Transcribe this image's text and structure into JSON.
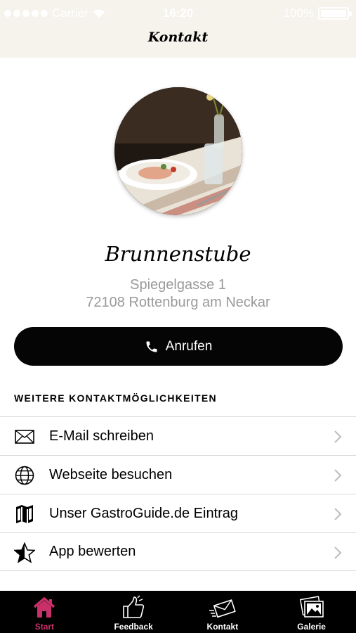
{
  "status_bar": {
    "carrier": "Carrier",
    "time": "16:20",
    "battery": "100%"
  },
  "nav": {
    "title": "Kontakt"
  },
  "restaurant": {
    "name": "Brunnenstube",
    "street": "Spiegelgasse 1",
    "city": "72108 Rottenburg am Neckar"
  },
  "call_button": {
    "label": "Anrufen"
  },
  "section": {
    "title": "WEITERE KONTAKTMÖGLICHKEITEN"
  },
  "contact_options": [
    {
      "label": "E-Mail schreiben",
      "icon": "envelope-icon"
    },
    {
      "label": "Webseite besuchen",
      "icon": "globe-icon"
    },
    {
      "label": "Unser GastroGuide.de Eintrag",
      "icon": "map-icon"
    },
    {
      "label": "App bewerten",
      "icon": "star-icon"
    }
  ],
  "tabs": [
    {
      "label": "Start",
      "icon": "home-icon",
      "active": true
    },
    {
      "label": "Feedback",
      "icon": "thumbs-up-icon",
      "active": false
    },
    {
      "label": "Kontakt",
      "icon": "envelope-icon",
      "active": false
    },
    {
      "label": "Galerie",
      "icon": "photos-icon",
      "active": false
    }
  ],
  "colors": {
    "accent": "#c8306a",
    "header_bg": "#f6f3ec",
    "tabbar_bg": "#000000",
    "button_bg": "#050505",
    "muted_text": "#9a9a9a"
  }
}
